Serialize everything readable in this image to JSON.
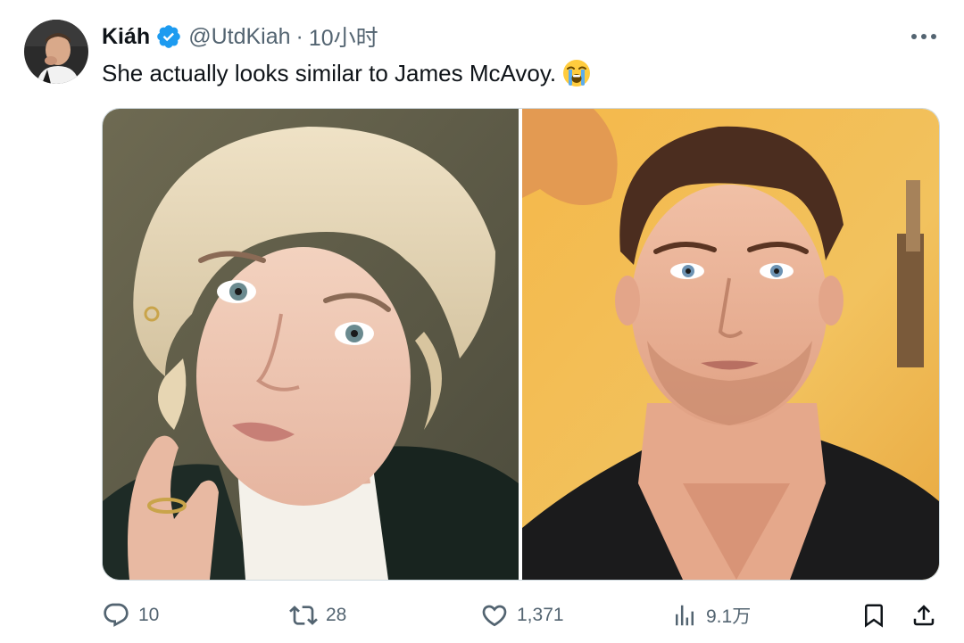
{
  "tweet": {
    "author": {
      "display_name": "Kiáh",
      "handle": "@UtdKiah",
      "verified": true
    },
    "separator": "·",
    "timestamp": "10小时",
    "text": "She actually looks similar to James McAvoy.",
    "emoji": "loudly-crying-face-emoji",
    "media": [
      {
        "icon": "photo-woman-blonde-short-hair"
      },
      {
        "icon": "photo-man-james-mcavoy"
      }
    ],
    "stats": {
      "replies": "10",
      "reposts": "28",
      "likes": "1,371",
      "views": "9.1万"
    }
  },
  "colors": {
    "text_primary": "#0f1419",
    "text_secondary": "#536471",
    "verified_blue": "#1d9bf0",
    "border": "#cfd9de"
  }
}
